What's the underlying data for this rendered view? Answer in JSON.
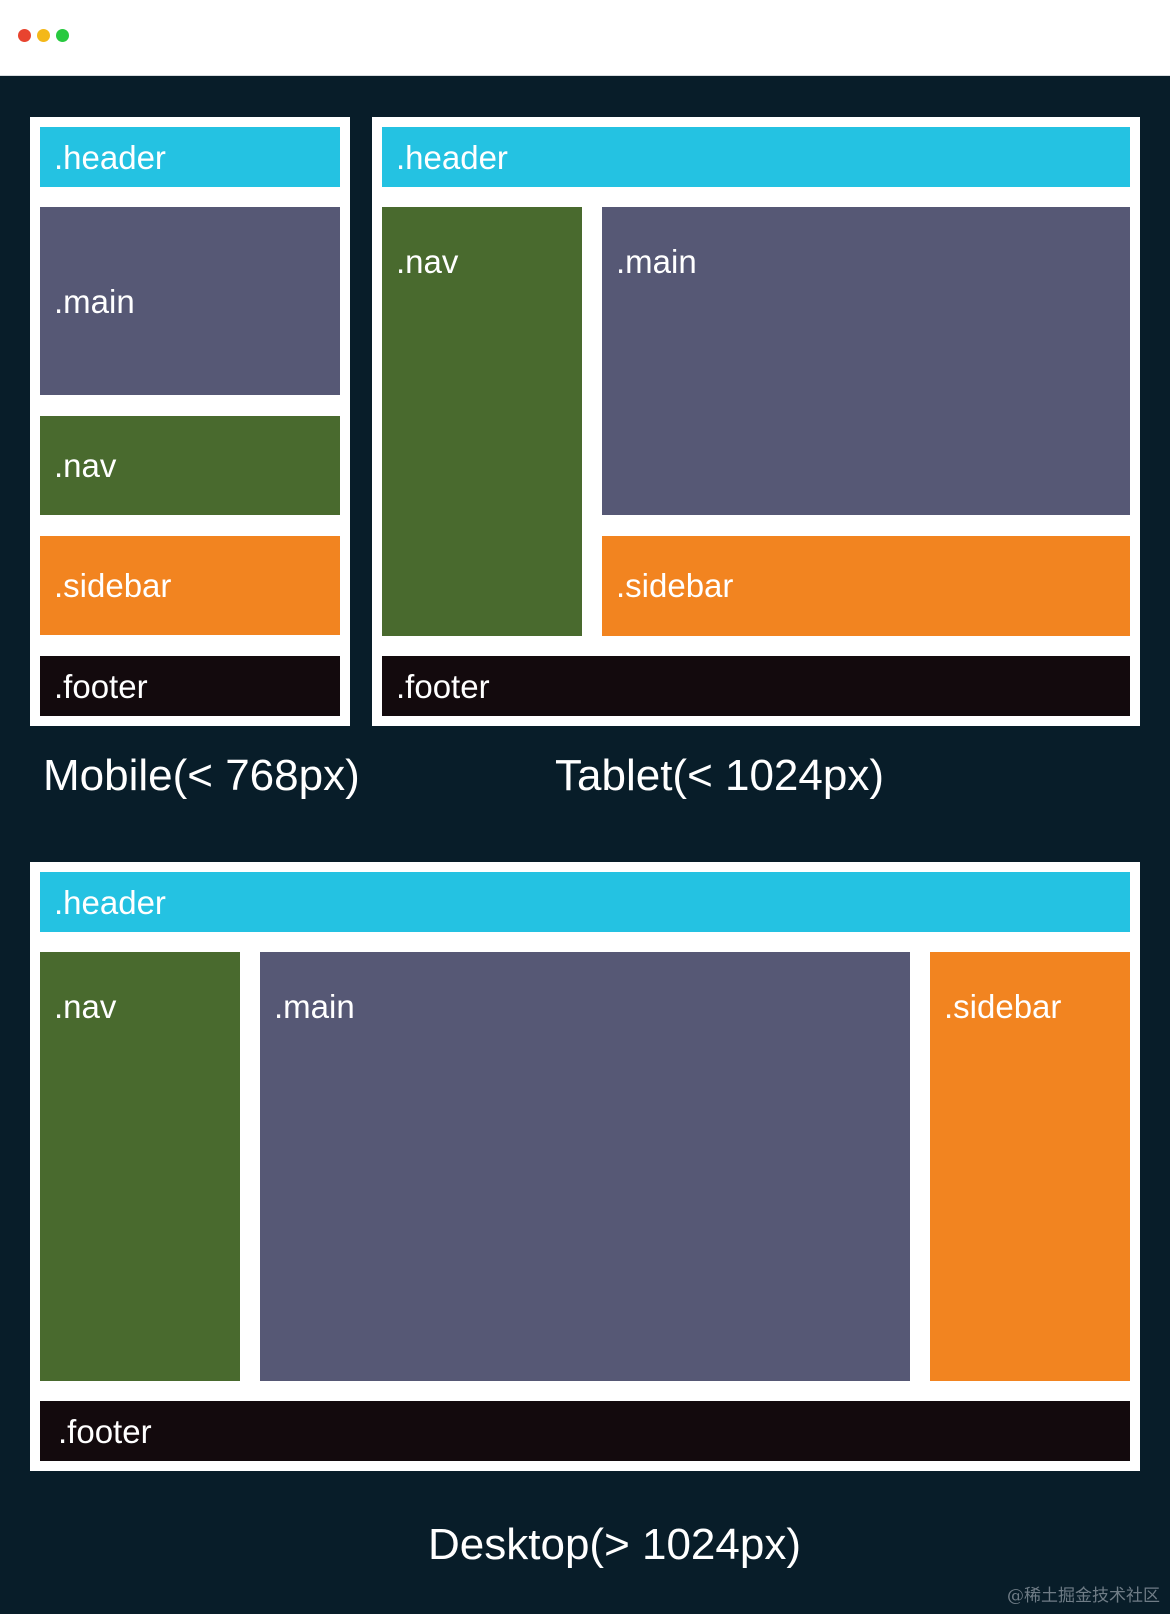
{
  "window": {
    "traffic_lights": [
      "red",
      "yellow",
      "green"
    ]
  },
  "colors": {
    "header": "#24c2e2",
    "main": "#565875",
    "nav": "#496a2e",
    "sidebar": "#f28420",
    "footer": "#130a0d",
    "background": "#081d29",
    "frame": "#ffffff"
  },
  "mobile": {
    "header": ".header",
    "main": ".main",
    "nav": ".nav",
    "sidebar": ".sidebar",
    "footer": ".footer",
    "caption": "Mobile(< 768px)"
  },
  "tablet": {
    "header": ".header",
    "nav": ".nav",
    "main": ".main",
    "sidebar": ".sidebar",
    "footer": ".footer",
    "caption": "Tablet(< 1024px)"
  },
  "desktop": {
    "header": ".header",
    "nav": ".nav",
    "main": ".main",
    "sidebar": ".sidebar",
    "footer": ".footer",
    "caption": "Desktop(> 1024px)"
  },
  "watermark": "@稀土掘金技术社区"
}
